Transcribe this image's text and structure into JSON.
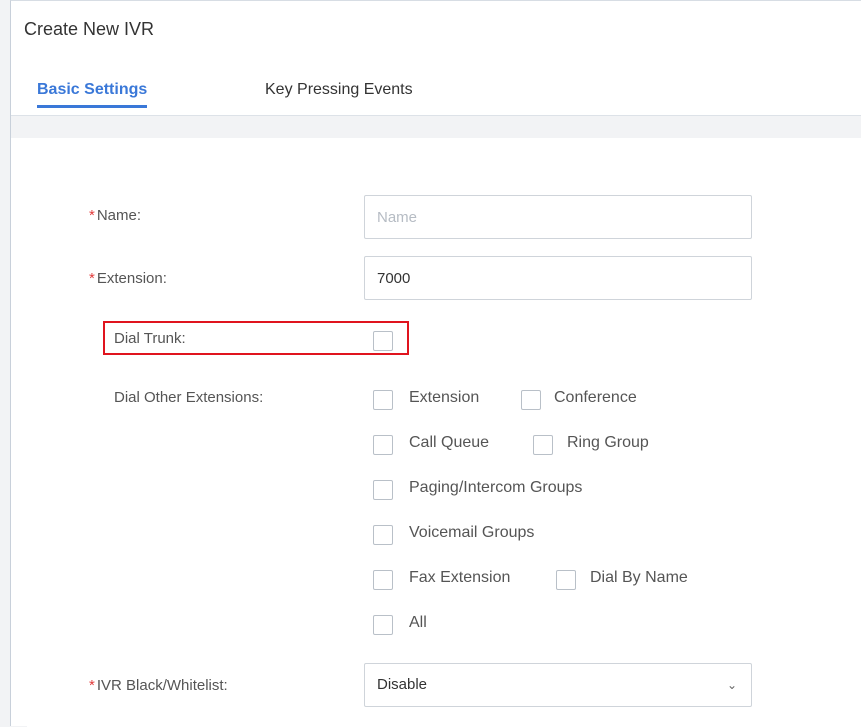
{
  "dialog": {
    "title": "Create New IVR",
    "tabs": [
      {
        "label": "Basic Settings",
        "active": true
      },
      {
        "label": "Key Pressing Events",
        "active": false
      }
    ]
  },
  "form": {
    "name": {
      "label": "Name:",
      "required": true,
      "value": "",
      "placeholder": "Name"
    },
    "extension": {
      "label": "Extension:",
      "required": true,
      "value": "7000"
    },
    "dial_trunk": {
      "label": "Dial Trunk:",
      "checked": false,
      "highlighted": true
    },
    "dial_other_extensions": {
      "label": "Dial Other Extensions:",
      "options": [
        {
          "label": "Extension",
          "checked": false
        },
        {
          "label": "Conference",
          "checked": false
        },
        {
          "label": "Call Queue",
          "checked": false
        },
        {
          "label": "Ring Group",
          "checked": false
        },
        {
          "label": "Paging/Intercom Groups",
          "checked": false
        },
        {
          "label": "Voicemail Groups",
          "checked": false
        },
        {
          "label": "Fax Extension",
          "checked": false
        },
        {
          "label": "Dial By Name",
          "checked": false
        },
        {
          "label": "All",
          "checked": false
        }
      ]
    },
    "ivr_blacklist": {
      "label": "IVR Black/Whitelist:",
      "required": true,
      "value": "Disable"
    }
  },
  "colors": {
    "accent": "#3a78d8",
    "required": "#e23b3b",
    "highlight": "#e0141e"
  }
}
